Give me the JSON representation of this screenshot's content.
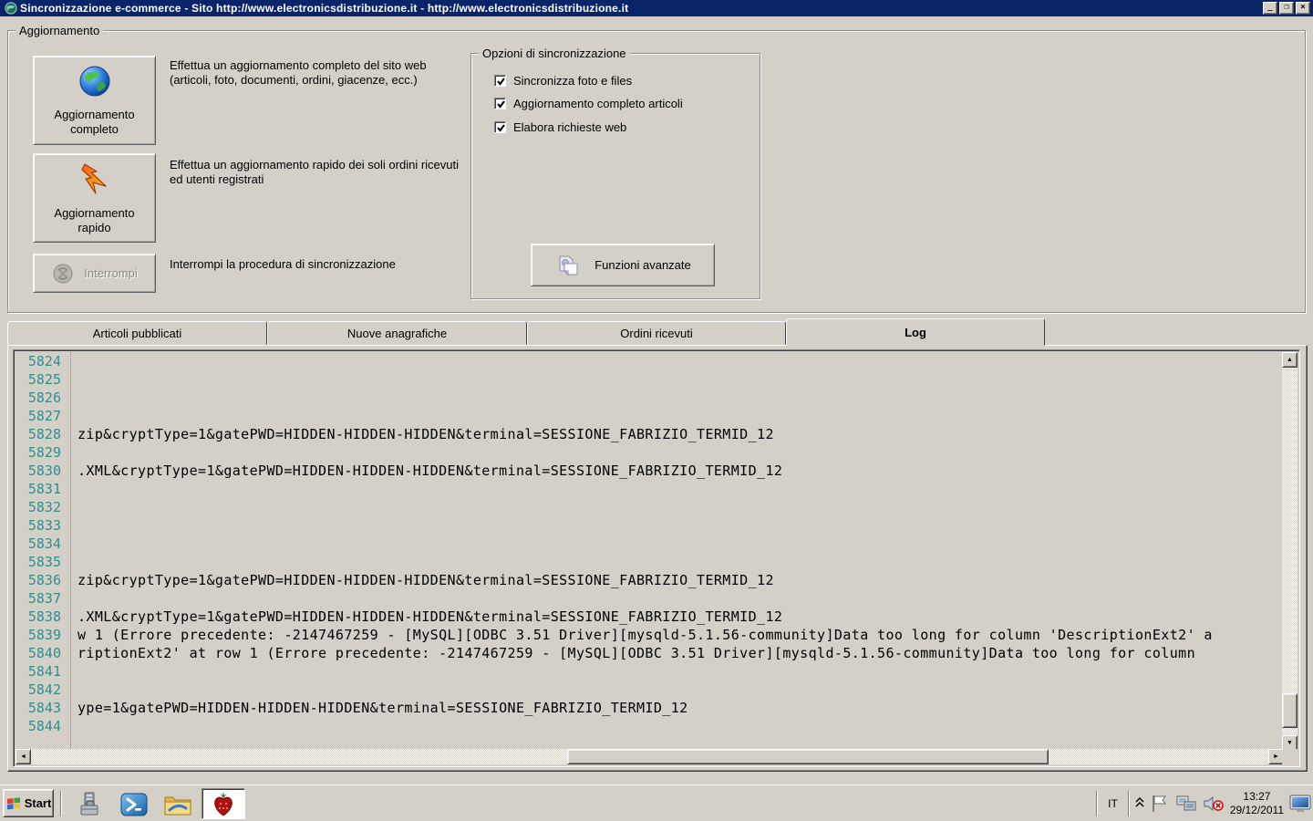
{
  "colors": {
    "titlebar": "#0a246a",
    "chrome": "#d4d0c8",
    "line_number_teal": "#2e8f8f",
    "log_text": "#000000"
  },
  "icons": {
    "minimize": "_",
    "restore": "❐",
    "close": "×",
    "scroll_up": "▲",
    "scroll_down": "▼",
    "scroll_left": "◄",
    "scroll_right": "►",
    "tray_chevron": "«"
  },
  "window": {
    "title": "Sincronizzazione e-commerce - Sito http://www.electronicsdistribuzione.it - http://www.electronicsdistribuzione.it"
  },
  "aggiornamento": {
    "group_label": "Aggiornamento",
    "actions": [
      {
        "label": "Aggiornamento completo",
        "description": "Effettua un aggiornamento completo del sito web (articoli, foto, documenti, ordini, giacenze, ecc.)",
        "enabled": true
      },
      {
        "label": "Aggiornamento rapido",
        "description": "Effettua un aggiornamento rapido dei soli ordini ricevuti ed utenti registrati",
        "enabled": true
      },
      {
        "label": "Interrompi",
        "description": "Interrompi la procedura di sincronizzazione",
        "enabled": false
      }
    ]
  },
  "sync_options": {
    "group_label": "Opzioni di sincronizzazione",
    "items": [
      {
        "label": "Sincronizza foto e files",
        "checked": true
      },
      {
        "label": "Aggiornamento completo articoli",
        "checked": true
      },
      {
        "label": "Elabora richieste web",
        "checked": true
      }
    ],
    "advanced_button_label": "Funzioni avanzate"
  },
  "tabs": [
    {
      "label": "Articoli pubblicati",
      "active": false
    },
    {
      "label": "Nuove anagrafiche",
      "active": false
    },
    {
      "label": "Ordini ricevuti",
      "active": false
    },
    {
      "label": "Log",
      "active": true
    }
  ],
  "log": {
    "lines": [
      {
        "n": "5824",
        "text": ""
      },
      {
        "n": "5825",
        "text": ""
      },
      {
        "n": "5826",
        "text": ""
      },
      {
        "n": "5827",
        "text": ""
      },
      {
        "n": "5828",
        "text": "zip&cryptType=1&gatePWD=HIDDEN-HIDDEN-HIDDEN&terminal=SESSIONE_FABRIZIO_TERMID_12"
      },
      {
        "n": "5829",
        "text": ""
      },
      {
        "n": "5830",
        "text": ".XML&cryptType=1&gatePWD=HIDDEN-HIDDEN-HIDDEN&terminal=SESSIONE_FABRIZIO_TERMID_12"
      },
      {
        "n": "5831",
        "text": ""
      },
      {
        "n": "5832",
        "text": ""
      },
      {
        "n": "5833",
        "text": ""
      },
      {
        "n": "5834",
        "text": ""
      },
      {
        "n": "5835",
        "text": ""
      },
      {
        "n": "5836",
        "text": "zip&cryptType=1&gatePWD=HIDDEN-HIDDEN-HIDDEN&terminal=SESSIONE_FABRIZIO_TERMID_12"
      },
      {
        "n": "5837",
        "text": ""
      },
      {
        "n": "5838",
        "text": ".XML&cryptType=1&gatePWD=HIDDEN-HIDDEN-HIDDEN&terminal=SESSIONE_FABRIZIO_TERMID_12"
      },
      {
        "n": "5839",
        "text": "w 1 (Errore precedente: -2147467259 - [MySQL][ODBC 3.51 Driver][mysqld-5.1.56-community]Data too long for column 'DescriptionExt2' a"
      },
      {
        "n": "5840",
        "text": "riptionExt2' at row 1 (Errore precedente: -2147467259 - [MySQL][ODBC 3.51 Driver][mysqld-5.1.56-community]Data too long for column"
      },
      {
        "n": "5841",
        "text": ""
      },
      {
        "n": "5842",
        "text": ""
      },
      {
        "n": "5843",
        "text": "ype=1&gatePWD=HIDDEN-HIDDEN-HIDDEN&terminal=SESSIONE_FABRIZIO_TERMID_12"
      },
      {
        "n": "5844",
        "text": ""
      }
    ]
  },
  "taskbar": {
    "start_label": "Start",
    "tray": {
      "language": "IT",
      "time": "13:27",
      "date": "29/12/2011"
    }
  }
}
